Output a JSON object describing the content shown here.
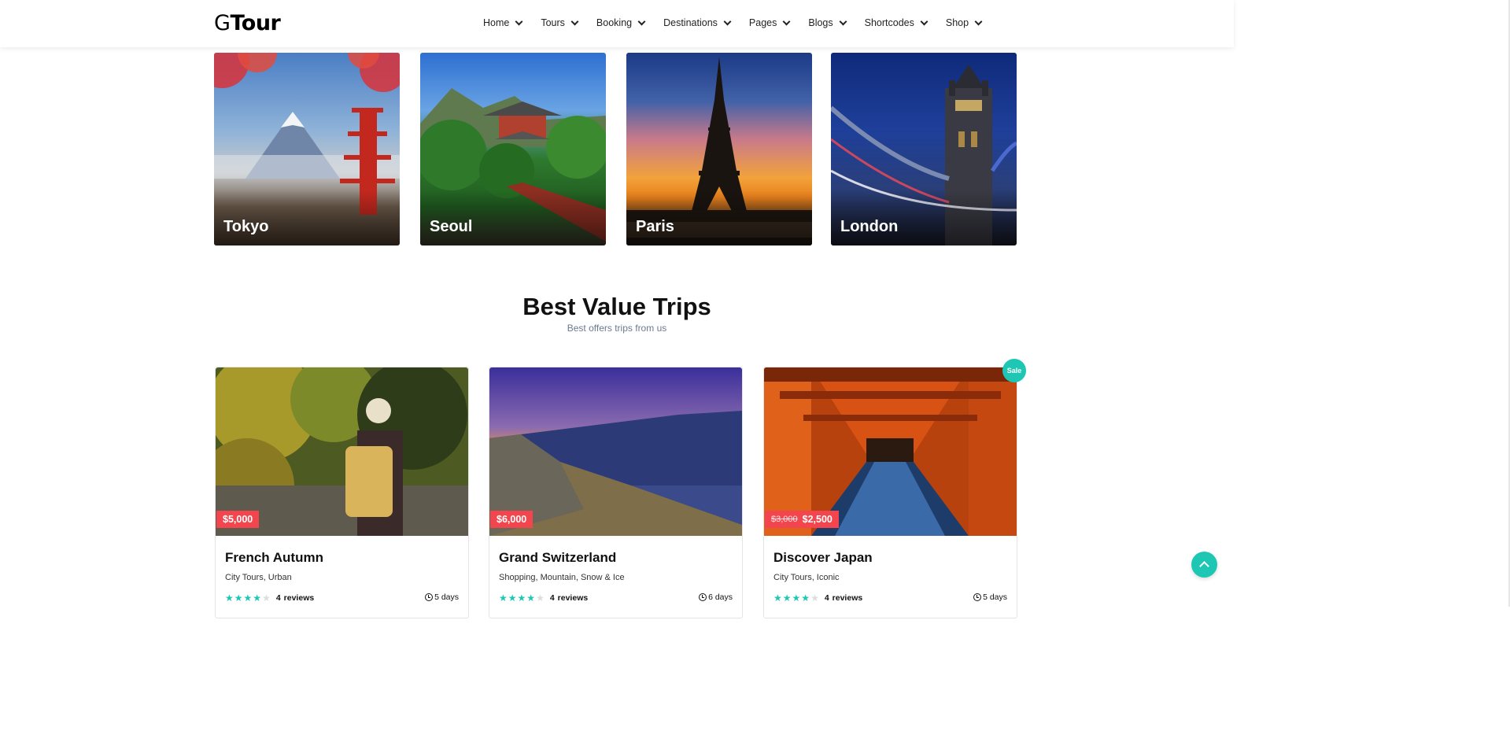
{
  "brand": {
    "logo_g": "G",
    "logo_rest": "Tour"
  },
  "nav": [
    {
      "label": "Home"
    },
    {
      "label": "Tours"
    },
    {
      "label": "Booking"
    },
    {
      "label": "Destinations"
    },
    {
      "label": "Pages"
    },
    {
      "label": "Blogs"
    },
    {
      "label": "Shortcodes"
    },
    {
      "label": "Shop"
    }
  ],
  "destinations": [
    {
      "name": "Tokyo"
    },
    {
      "name": "Seoul"
    },
    {
      "name": "Paris"
    },
    {
      "name": "London"
    }
  ],
  "section": {
    "title": "Best Value Trips",
    "subtitle": "Best offers trips from us"
  },
  "trips": [
    {
      "price": "$5,000",
      "old_price": "",
      "title": "French Autumn",
      "categories": "City Tours, Urban",
      "rating": 4,
      "reviews": "4",
      "reviews_label": "reviews",
      "duration": "5 days"
    },
    {
      "price": "$6,000",
      "old_price": "",
      "title": "Grand Switzerland",
      "categories": "Shopping, Mountain, Snow & Ice",
      "rating": 4,
      "reviews": "4",
      "reviews_label": "reviews",
      "duration": "6 days"
    },
    {
      "price": "$2,500",
      "old_price": "$3,000",
      "title": "Discover Japan",
      "categories": "City Tours, Iconic",
      "rating": 4,
      "reviews": "4",
      "reviews_label": "reviews",
      "duration": "5 days"
    }
  ],
  "sale_badge": "Sale",
  "colors": {
    "accent": "#1ec6b4",
    "price_tag": "#f2454e"
  },
  "icons": {
    "back_to_top": "chevron-up-icon",
    "duration": "clock-icon",
    "rating": "star-icon",
    "nav_dropdown": "chevron-down-icon"
  }
}
